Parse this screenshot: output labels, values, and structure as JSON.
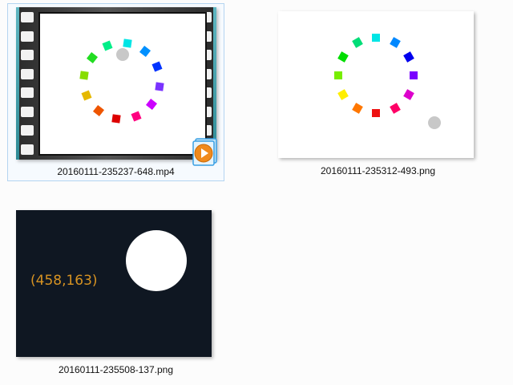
{
  "files": [
    {
      "name": "20160111-235237-648.mp4",
      "type": "video",
      "selected": true,
      "badge_icon": "media-player-play-icon"
    },
    {
      "name": "20160111-235312-493.png",
      "type": "image",
      "selected": false
    },
    {
      "name": "20160111-235508-137.png",
      "type": "image",
      "selected": false,
      "overlay_text": "(458,163)"
    }
  ],
  "colors": {
    "selection_bg": "#f6fafe",
    "selection_border": "#b4d4f1",
    "dark_thumb_bg": "#0f1722",
    "coord_text": "#d79322",
    "marker": "#c8c8c8",
    "badge_orange": "#f08a1c",
    "badge_blue": "#3aa0e4"
  },
  "ring_colors": [
    "#00e5e5",
    "#0090ff",
    "#0033ff",
    "#7a33ff",
    "#cc00ff",
    "#ff0080",
    "#dd0000",
    "#ee5500",
    "#e5b800",
    "#88dd00",
    "#22dd22",
    "#00ee88"
  ],
  "ring_colors_2": [
    "#00dd77",
    "#00e5e5",
    "#0088ff",
    "#0000ee",
    "#7a00ff",
    "#dd00cc",
    "#ff0066",
    "#ee1111",
    "#ff7700",
    "#ffee00",
    "#77ee00",
    "#00dd00"
  ]
}
